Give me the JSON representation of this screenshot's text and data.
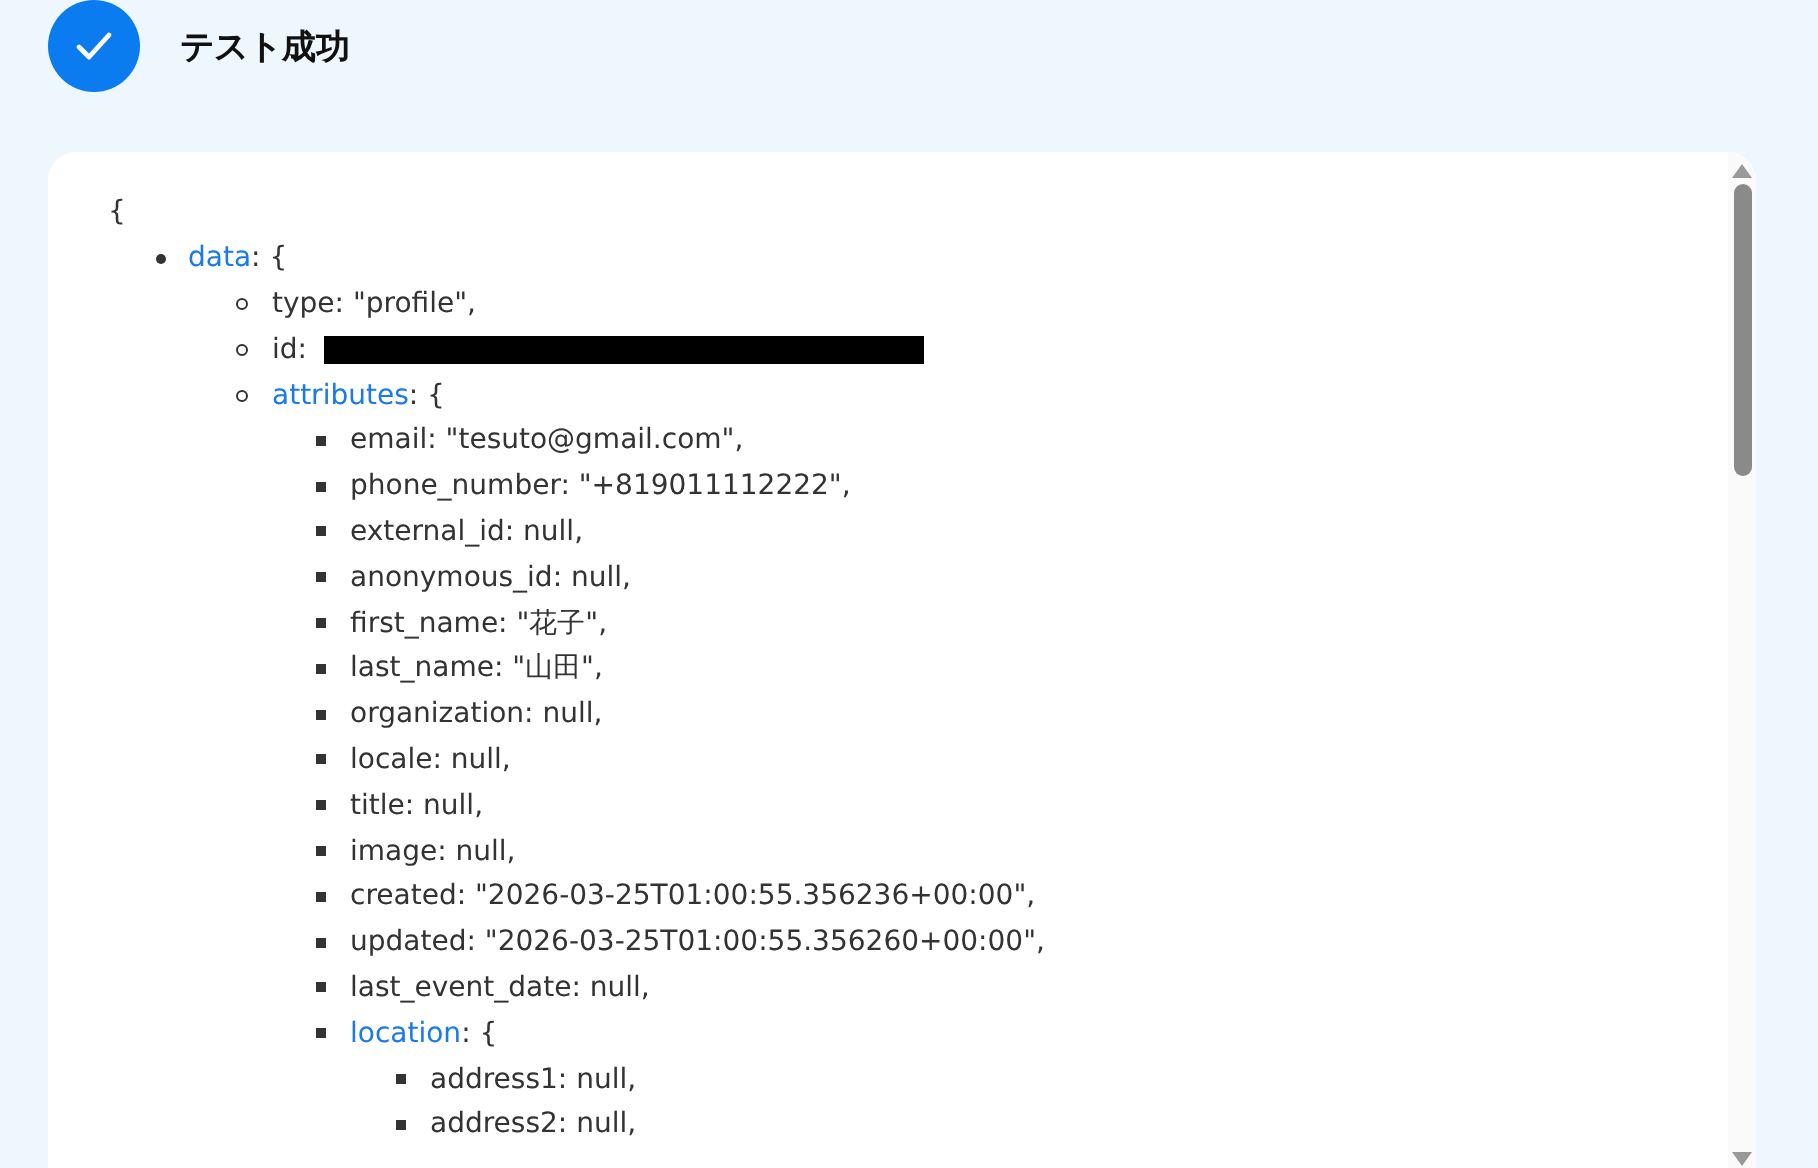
{
  "header": {
    "title": "テスト成功",
    "success": true
  },
  "json_view": {
    "opening": "{",
    "nodes": [
      {
        "key": "data",
        "text": ": {",
        "children": [
          {
            "text": "type: \"profile\","
          },
          {
            "text": "id:",
            "redacted": true
          },
          {
            "key": "attributes",
            "text": ": {",
            "children": [
              {
                "text": "email: \"tesuto@gmail.com\","
              },
              {
                "text": "phone_number: \"+819011112222\","
              },
              {
                "text": "external_id: null,"
              },
              {
                "text": "anonymous_id: null,"
              },
              {
                "text": "first_name: \"花子\","
              },
              {
                "text": "last_name: \"山田\","
              },
              {
                "text": "organization: null,"
              },
              {
                "text": "locale: null,"
              },
              {
                "text": "title: null,"
              },
              {
                "text": "image: null,"
              },
              {
                "text": "created: \"2026-03-25T01:00:55.356236+00:00\","
              },
              {
                "text": "updated: \"2026-03-25T01:00:55.356260+00:00\","
              },
              {
                "text": "last_event_date: null,"
              },
              {
                "key": "location",
                "text": ": {",
                "children": [
                  {
                    "text": "address1: null,"
                  },
                  {
                    "text": "address2: null,"
                  }
                ]
              }
            ]
          }
        ]
      }
    ]
  }
}
